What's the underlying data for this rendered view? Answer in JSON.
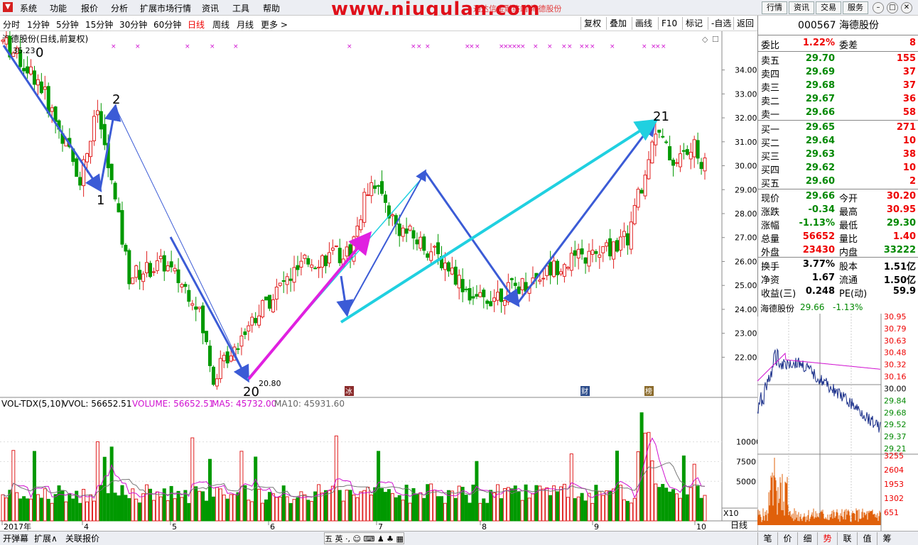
{
  "menubar": {
    "items": [
      "系统",
      "功能",
      "报价",
      "分析",
      "扩展市场行情",
      "资讯",
      "工具",
      "帮助"
    ],
    "watermark": "www.niugulan.com",
    "red_subtitle": "通达信金融终端   海德股份",
    "right_buttons": [
      "行情",
      "资讯",
      "交易",
      "服务"
    ]
  },
  "periods": {
    "items": [
      "分时",
      "1分钟",
      "5分钟",
      "15分钟",
      "30分钟",
      "60分钟",
      "日线",
      "周线",
      "月线",
      "更多 >"
    ],
    "active": "日线"
  },
  "chart_tools": [
    "复权",
    "叠加",
    "画线",
    "F10",
    "标记",
    "-自选",
    "返回"
  ],
  "chart_header": "海德股份(日线,前复权)",
  "vol_header": {
    "name": "VOL-TDX(5,10)",
    "vvol": "VVOL: 56652.51",
    "volume": "VOLUME: 56652.51",
    "ma5": "MA5: 45732.00",
    "ma10": "MA10: 45931.60"
  },
  "price_axis": [
    "34.00",
    "33.00",
    "32.00",
    "31.00",
    "30.00",
    "29.00",
    "28.00",
    "27.00",
    "26.00",
    "25.00",
    "24.00",
    "23.00",
    "22.00"
  ],
  "vol_axis": [
    "10000",
    "7500",
    "5000"
  ],
  "x10_label": "X10",
  "date_axis": [
    "2017年",
    "4",
    "5",
    "6",
    "7",
    "8",
    "9",
    "10"
  ],
  "period_label_bottom": "日线",
  "annotations": {
    "high_price": "35.23",
    "low_price": "20.80",
    "wave_labels": [
      "0",
      "1",
      "2",
      "20",
      "21"
    ],
    "event_markers": [
      "冰",
      "财",
      "榜"
    ]
  },
  "quote": {
    "code_name": "000567 海德股份",
    "weibi_label": "委比",
    "weibi": "1.22%",
    "weicha_label": "委差",
    "weicha": "8",
    "asks": [
      {
        "label": "卖五",
        "price": "29.70",
        "vol": "155"
      },
      {
        "label": "卖四",
        "price": "29.69",
        "vol": "37"
      },
      {
        "label": "卖三",
        "price": "29.68",
        "vol": "37"
      },
      {
        "label": "卖二",
        "price": "29.67",
        "vol": "36"
      },
      {
        "label": "卖一",
        "price": "29.66",
        "vol": "58"
      }
    ],
    "bids": [
      {
        "label": "买一",
        "price": "29.65",
        "vol": "271"
      },
      {
        "label": "买二",
        "price": "29.64",
        "vol": "10"
      },
      {
        "label": "买三",
        "price": "29.63",
        "vol": "38"
      },
      {
        "label": "买四",
        "price": "29.62",
        "vol": "10"
      },
      {
        "label": "买五",
        "price": "29.60",
        "vol": "2"
      }
    ],
    "stats": [
      {
        "l1": "现价",
        "v1": "29.66",
        "l2": "今开",
        "v2": "30.20"
      },
      {
        "l1": "涨跌",
        "v1": "-0.34",
        "l2": "最高",
        "v2": "30.95"
      },
      {
        "l1": "涨幅",
        "v1": "-1.13%",
        "l2": "最低",
        "v2": "29.30"
      },
      {
        "l1": "总量",
        "v1": "56652",
        "l2": "量比",
        "v2": "1.40"
      },
      {
        "l1": "外盘",
        "v1": "23430",
        "l2": "内盘",
        "v2": "33222"
      }
    ],
    "stats2": [
      {
        "l1": "换手",
        "v1": "3.77%",
        "l2": "股本",
        "v2": "1.51亿"
      },
      {
        "l1": "净资",
        "v1": "1.67",
        "l2": "流通",
        "v2": "1.50亿"
      },
      {
        "l1": "收益(三)",
        "v1": "0.248",
        "l2": "PE(动)",
        "v2": "59.9"
      }
    ]
  },
  "mini_chart": {
    "name": "海德股份",
    "price": "29.66",
    "pct": "-1.13%",
    "price_ticks": [
      "30.95",
      "30.79",
      "30.63",
      "30.48",
      "30.32",
      "30.16",
      "30.00",
      "29.84",
      "29.68",
      "29.52",
      "29.37",
      "29.21"
    ],
    "vol_ticks": [
      "3255",
      "2604",
      "1953",
      "1302",
      "651"
    ]
  },
  "bottombar": {
    "left_buttons": [
      "开弹幕",
      "扩展∧",
      "关联报价"
    ],
    "ime": "五 英 ·, ☺ ⌨ ♟ ♣ ▦",
    "right_tabs": [
      "笔",
      "价",
      "细",
      "势",
      "联",
      "值",
      "筹"
    ],
    "active_tab": "势"
  },
  "colors": {
    "up": "#e02020",
    "down": "#009900",
    "wave_blue": "#3b5bd6",
    "magenta": "#e020e0",
    "cyan": "#20d0e0"
  },
  "chart_data": {
    "type": "candlestick",
    "ylim": [
      20.5,
      35.5
    ],
    "wave_points": [
      {
        "label": "0",
        "price": 35.23
      },
      {
        "label": "1",
        "price": 29.2
      },
      {
        "label": "2",
        "price": 32.6
      },
      {
        "label": "20",
        "price": 20.8
      },
      {
        "label": "21",
        "price": 32.0
      }
    ]
  }
}
